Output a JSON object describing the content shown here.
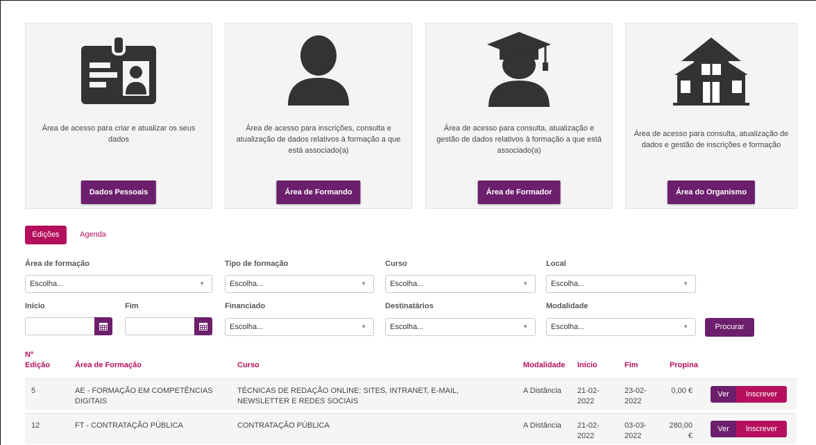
{
  "cards": [
    {
      "icon": "id-card-icon",
      "description": "Área de acesso para criar e atualizar os seus dados",
      "button": "Dados Pessoais"
    },
    {
      "icon": "user-icon",
      "description": "Área de acesso para inscrições, consulta e atualização de dados relativos à formação a que está associado(a)",
      "button": "Área de Formando"
    },
    {
      "icon": "graduate-icon",
      "description": "Área de acesso para consulta, atualização e gestão de dados relativos à formação a que está associado(a)",
      "button": "Área de Formador"
    },
    {
      "icon": "building-icon",
      "description": "Área de acesso para consulta, atualização de dados e gestão de inscrições e formação",
      "button": "Área do Organismo"
    }
  ],
  "tabs": {
    "active": "Edições",
    "other": "Agenda"
  },
  "filters": {
    "area_label": "Área de formação",
    "area_value": "Escolha...",
    "tipo_label": "Tipo de formação",
    "tipo_value": "Escolha...",
    "curso_label": "Curso",
    "curso_value": "Escolha...",
    "local_label": "Local",
    "local_value": "Escolha...",
    "inicio_label": "Início",
    "fim_label": "Fim",
    "financiado_label": "Financiado",
    "financiado_value": "Escolha...",
    "destinatarios_label": "Destinatários",
    "destinatarios_value": "Escolha...",
    "modalidade_label": "Modalidade",
    "modalidade_value": "Escolha...",
    "search_button": "Procurar"
  },
  "table": {
    "headers": {
      "edicao_1": "Nº",
      "edicao_2": "Edição",
      "area": "Área de Formação",
      "curso": "Curso",
      "modalidade": "Modalidade",
      "inicio": "Início",
      "fim": "Fim",
      "propina": "Propina"
    },
    "rows": [
      {
        "edicao": "5",
        "area_1": "AE - FORMAÇÃO EM COMPETÊNCIAS",
        "area_2": "DIGITAIS",
        "curso_1": "TÉCNICAS DE REDAÇÃO ONLINE: SITES, INTRANET, E-MAIL,",
        "curso_2": "NEWSLETTER E REDES SOCIAIS",
        "modalidade": "A Distância",
        "inicio_1": "21-02-",
        "inicio_2": "2022",
        "fim_1": "23-02-",
        "fim_2": "2022",
        "propina_1": "0,00 €",
        "propina_2": "",
        "ver": "Ver",
        "inscrever": "Inscrever"
      },
      {
        "edicao": "12",
        "area_1": "FT - CONTRATAÇÃO PÚBLICA",
        "area_2": "",
        "curso_1": "CONTRATAÇÃO PÚBLICA",
        "curso_2": "",
        "modalidade": "A Distância",
        "inicio_1": "21-02-",
        "inicio_2": "2022",
        "fim_1": "03-03-",
        "fim_2": "2022",
        "propina_1": "280,00",
        "propina_2": "€",
        "ver": "Ver",
        "inscrever": "Inscrever"
      }
    ]
  },
  "colors": {
    "primary": "#6c1f6c",
    "accent": "#b5105e",
    "icon": "#333333"
  }
}
